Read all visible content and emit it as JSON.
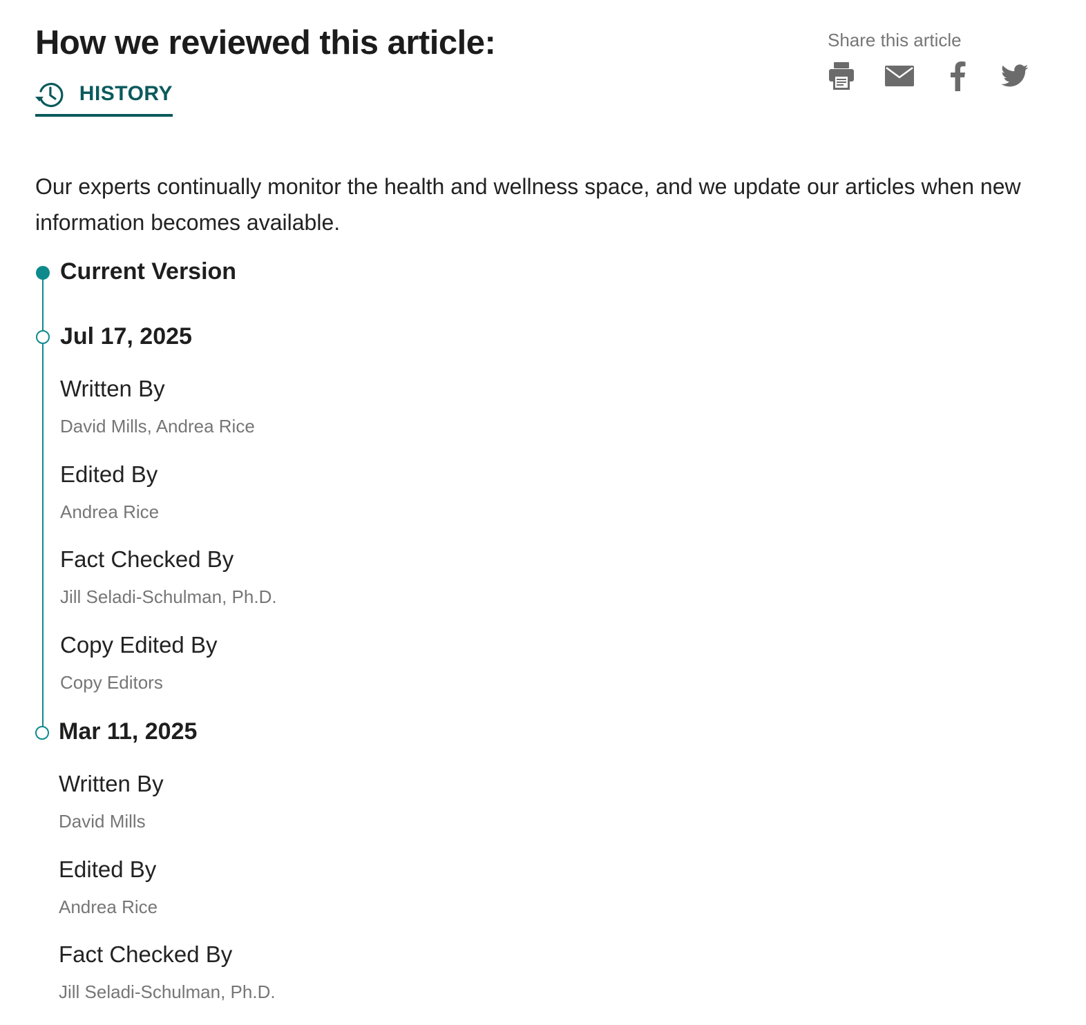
{
  "header": {
    "title": "How we reviewed this article:",
    "history_tab_label": "HISTORY"
  },
  "share": {
    "label": "Share this article",
    "icons": [
      "print-icon",
      "email-icon",
      "facebook-icon",
      "twitter-icon"
    ]
  },
  "intro": "Our experts continually monitor the health and wellness space, and we update our articles when new information becomes available.",
  "timeline": {
    "current_label": "Current Version",
    "versions": [
      {
        "date": "Jul 17, 2025",
        "credits": [
          {
            "role": "Written By",
            "people": "David Mills, Andrea Rice"
          },
          {
            "role": "Edited By",
            "people": "Andrea Rice"
          },
          {
            "role": "Fact Checked By",
            "people": "Jill Seladi-Schulman, Ph.D."
          },
          {
            "role": "Copy Edited By",
            "people": "Copy Editors"
          }
        ]
      },
      {
        "date": "Mar 11, 2025",
        "credits": [
          {
            "role": "Written By",
            "people": "David Mills"
          },
          {
            "role": "Edited By",
            "people": "Andrea Rice"
          },
          {
            "role": "Fact Checked By",
            "people": "Jill Seladi-Schulman, Ph.D."
          }
        ]
      }
    ]
  },
  "colors": {
    "accent_dark": "#0b5a5c",
    "timeline": "#0e8a8c",
    "muted_text": "#767676",
    "icon_gray": "#6b6b6b"
  }
}
